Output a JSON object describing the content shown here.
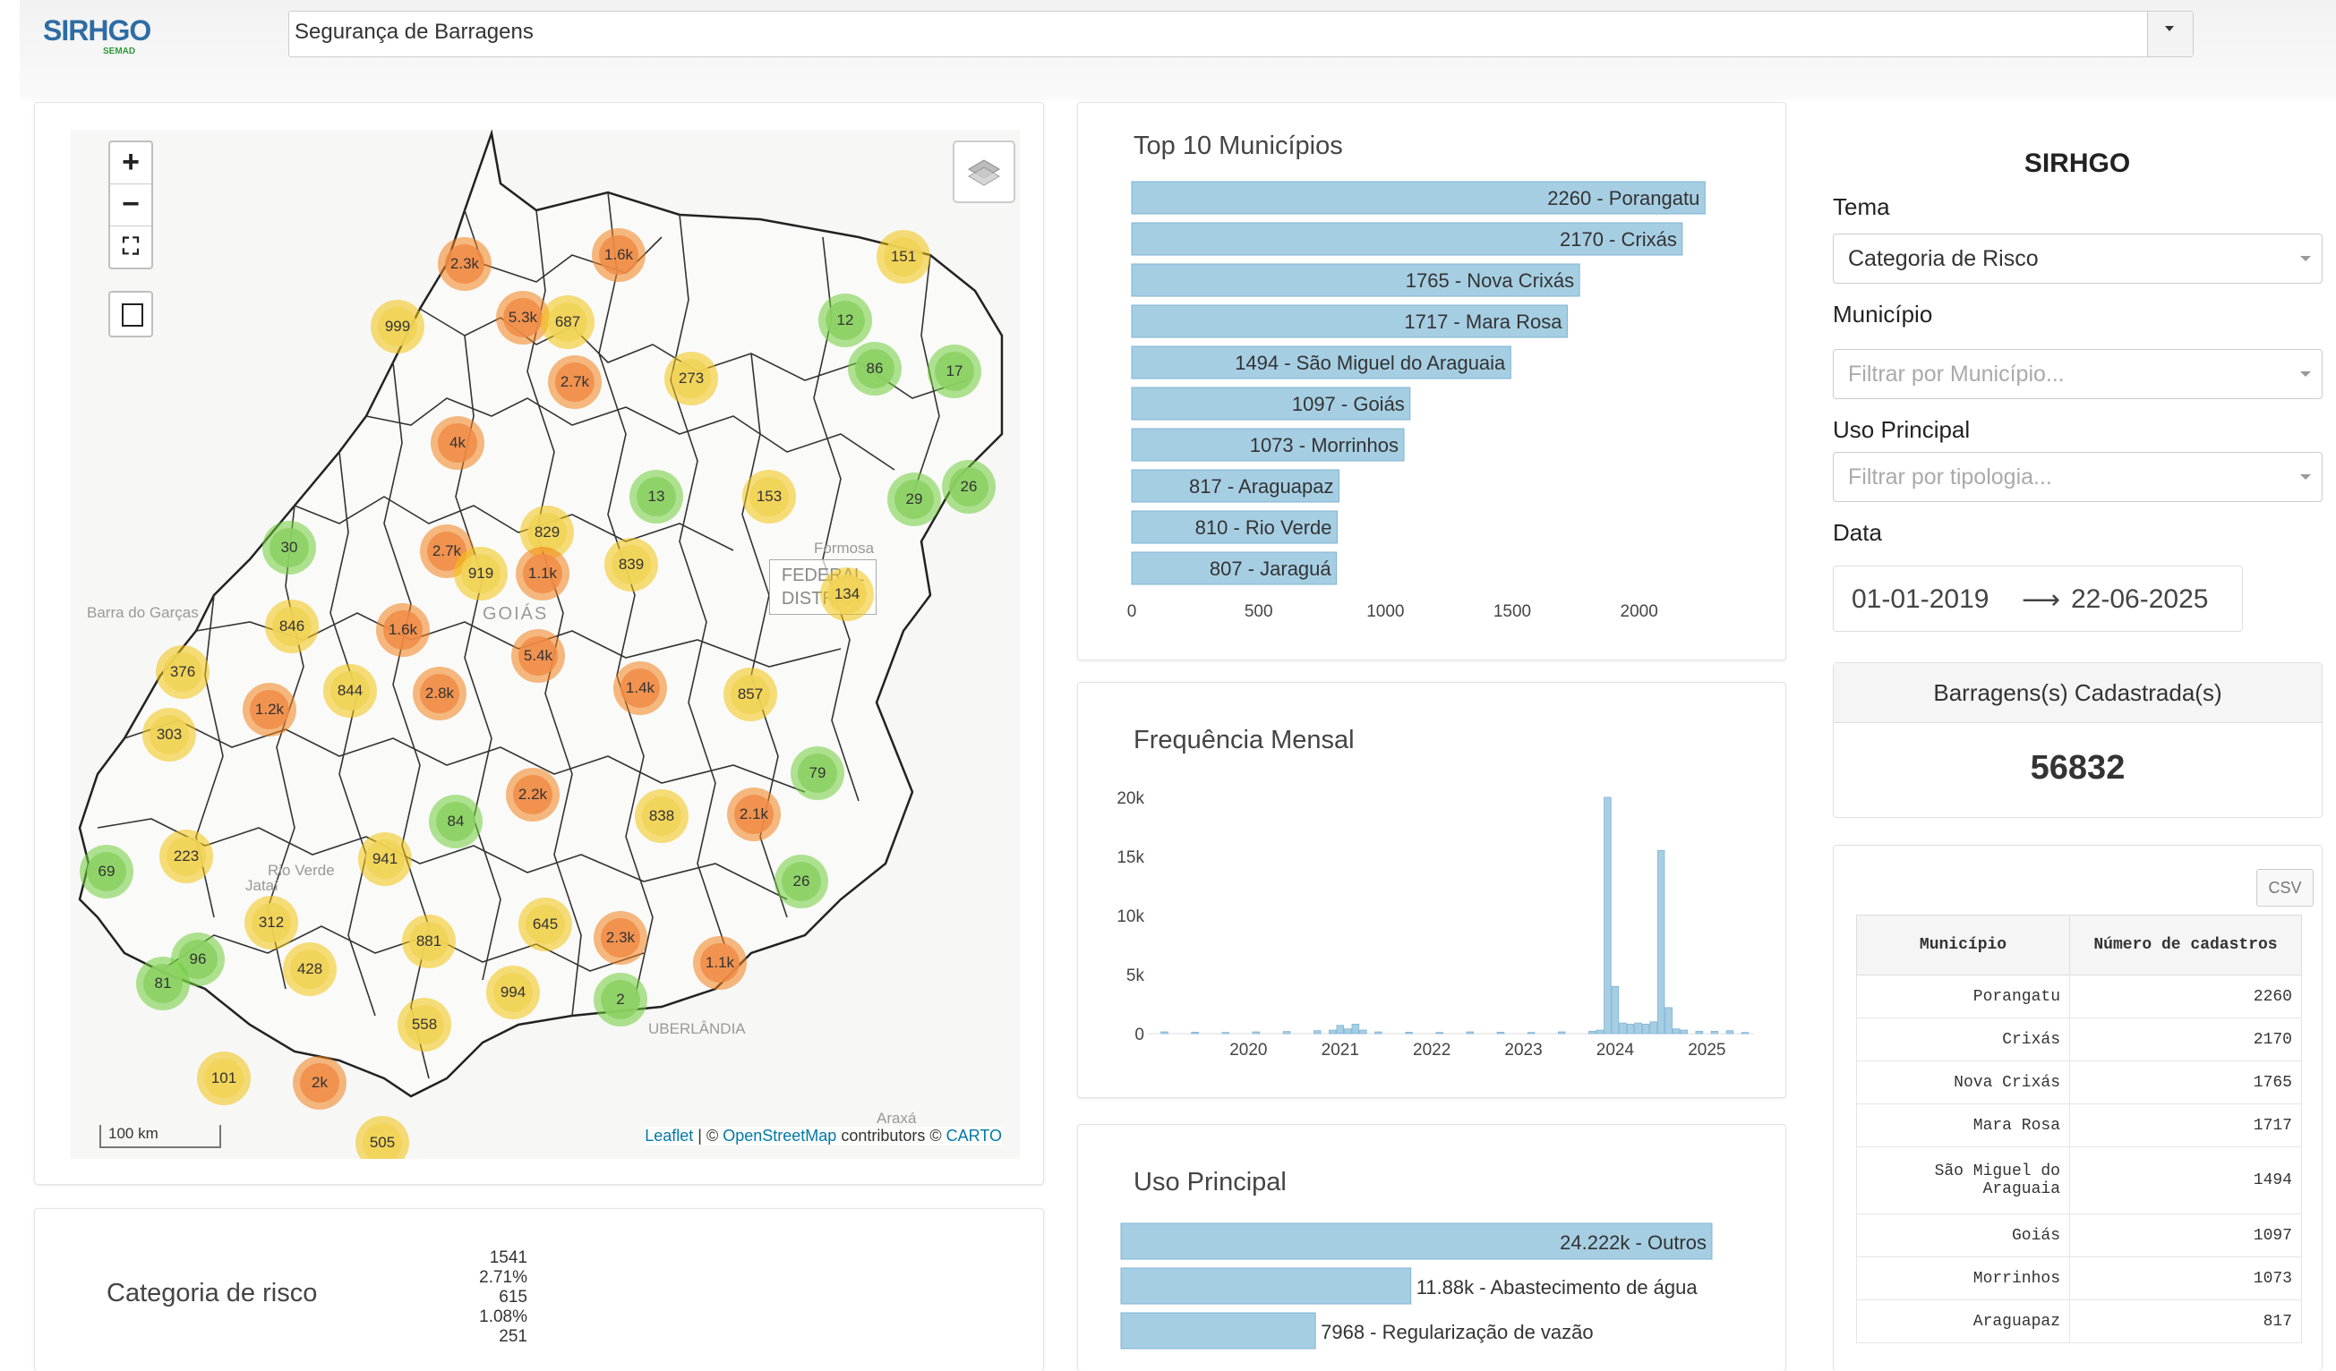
{
  "header": {
    "logo_text": "SIRHGO",
    "logo_sub": "SEMAD",
    "theme_select": "Segurança de Barragens"
  },
  "map": {
    "zoom_in": "+",
    "zoom_out": "−",
    "fullscreen": "⛶",
    "scale": "100 km",
    "attribution_leaflet": "Leaflet",
    "attribution_mid": " | © ",
    "attribution_osm": "OpenStreetMap",
    "attribution_contrib": " contributors © ",
    "attribution_carto": "CARTO",
    "labels": {
      "goias": "GOIÁS",
      "barra": "Barra do Garças",
      "uberlandia": "UBERLÂNDIA",
      "araxa": "Araxá",
      "formosa": "Formosa",
      "fed": "FEDERAL DISTRICT",
      "rio_verde": "Rio Verde",
      "jatai": "Jataí"
    },
    "clusters": [
      {
        "label": "2.3k",
        "level": "red"
      },
      {
        "label": "1.6k",
        "level": "red"
      },
      {
        "label": "151",
        "level": "yel"
      },
      {
        "label": "999",
        "level": "yel"
      },
      {
        "label": "5.3k",
        "level": "red"
      },
      {
        "label": "687",
        "level": "yel"
      },
      {
        "label": "12",
        "level": "grn"
      },
      {
        "label": "86",
        "level": "grn"
      },
      {
        "label": "17",
        "level": "grn"
      },
      {
        "label": "2.7k",
        "level": "red"
      },
      {
        "label": "273",
        "level": "yel"
      },
      {
        "label": "4k",
        "level": "red"
      },
      {
        "label": "13",
        "level": "grn"
      },
      {
        "label": "153",
        "level": "yel"
      },
      {
        "label": "29",
        "level": "grn"
      },
      {
        "label": "26",
        "level": "grn"
      },
      {
        "label": "829",
        "level": "yel"
      },
      {
        "label": "30",
        "level": "grn"
      },
      {
        "label": "2.7k",
        "level": "red"
      },
      {
        "label": "839",
        "level": "yel"
      },
      {
        "label": "919",
        "level": "yel"
      },
      {
        "label": "1.1k",
        "level": "red"
      },
      {
        "label": "134",
        "level": "yel"
      },
      {
        "label": "846",
        "level": "yel"
      },
      {
        "label": "1.6k",
        "level": "red"
      },
      {
        "label": "5.4k",
        "level": "red"
      },
      {
        "label": "376",
        "level": "yel"
      },
      {
        "label": "1.4k",
        "level": "red"
      },
      {
        "label": "844",
        "level": "yel"
      },
      {
        "label": "2.8k",
        "level": "red"
      },
      {
        "label": "857",
        "level": "yel"
      },
      {
        "label": "1.2k",
        "level": "red"
      },
      {
        "label": "303",
        "level": "yel"
      },
      {
        "label": "79",
        "level": "grn"
      },
      {
        "label": "2.2k",
        "level": "red"
      },
      {
        "label": "838",
        "level": "yel"
      },
      {
        "label": "2.1k",
        "level": "red"
      },
      {
        "label": "84",
        "level": "grn"
      },
      {
        "label": "223",
        "level": "yel"
      },
      {
        "label": "941",
        "level": "yel"
      },
      {
        "label": "69",
        "level": "grn"
      },
      {
        "label": "26",
        "level": "grn"
      },
      {
        "label": "312",
        "level": "yel"
      },
      {
        "label": "645",
        "level": "yel"
      },
      {
        "label": "881",
        "level": "yel"
      },
      {
        "label": "2.3k",
        "level": "red"
      },
      {
        "label": "96",
        "level": "grn"
      },
      {
        "label": "1.1k",
        "level": "red"
      },
      {
        "label": "428",
        "level": "yel"
      },
      {
        "label": "81",
        "level": "grn"
      },
      {
        "label": "994",
        "level": "yel"
      },
      {
        "label": "2",
        "level": "grn"
      },
      {
        "label": "558",
        "level": "yel"
      },
      {
        "label": "101",
        "level": "yel"
      },
      {
        "label": "2k",
        "level": "red"
      },
      {
        "label": "505",
        "level": "yel"
      }
    ]
  },
  "categoria": {
    "title": "Categoria de risco",
    "values": [
      "1541",
      "2.71%",
      "615",
      "1.08%",
      "251"
    ]
  },
  "top10": {
    "title": "Top 10 Municípios",
    "chart_data": {
      "type": "bar",
      "orientation": "horizontal",
      "categories": [
        "Porangatu",
        "Crixás",
        "Nova Crixás",
        "Mara Rosa",
        "São Miguel do Araguaia",
        "Goiás",
        "Morrinhos",
        "Araguapaz",
        "Rio Verde",
        "Jaraguá"
      ],
      "values": [
        2260,
        2170,
        1765,
        1717,
        1494,
        1097,
        1073,
        817,
        810,
        807
      ],
      "bar_labels": [
        "2260 - Porangatu",
        "2170 - Crixás",
        "1765 - Nova Crixás",
        "1717 - Mara Rosa",
        "1494 - São Miguel do Araguaia",
        "1097 - Goiás",
        "1073 - Morrinhos",
        "817 - Araguapaz",
        "810 - Rio Verde",
        "807 - Jaraguá"
      ],
      "xticks": [
        "0",
        "500",
        "1000",
        "1500",
        "2000"
      ],
      "xlim": [
        0,
        2400
      ],
      "color": "#a6cee3"
    }
  },
  "freq": {
    "title": "Frequência Mensal",
    "chart_data": {
      "type": "bar",
      "x": [
        "2019-02",
        "2019-06",
        "2019-10",
        "2020-02",
        "2020-06",
        "2020-10",
        "2020-12",
        "2021-01",
        "2021-02",
        "2021-03",
        "2021-04",
        "2021-06",
        "2021-10",
        "2022-02",
        "2022-06",
        "2022-10",
        "2023-02",
        "2023-06",
        "2023-10",
        "2023-11",
        "2023-12",
        "2024-01",
        "2024-02",
        "2024-03",
        "2024-04",
        "2024-05",
        "2024-06",
        "2024-07",
        "2024-08",
        "2024-09",
        "2024-10",
        "2024-12",
        "2025-02",
        "2025-04",
        "2025-06"
      ],
      "values": [
        150,
        120,
        100,
        150,
        180,
        250,
        300,
        700,
        400,
        800,
        300,
        150,
        120,
        100,
        150,
        120,
        100,
        150,
        200,
        300,
        20000,
        4000,
        900,
        800,
        900,
        800,
        1000,
        15500,
        2200,
        400,
        300,
        200,
        200,
        250,
        100
      ],
      "yticks": [
        "0",
        "5k",
        "10k",
        "15k",
        "20k"
      ],
      "xticks": [
        "2020",
        "2021",
        "2022",
        "2023",
        "2024",
        "2025"
      ],
      "ylim": [
        0,
        20000
      ],
      "xlim": [
        "2019-01",
        "2025-06"
      ],
      "color": "#a6cee3"
    }
  },
  "uso": {
    "title": "Uso Principal",
    "chart_data": {
      "type": "bar",
      "orientation": "horizontal",
      "categories": [
        "Outros",
        "Abastecimento de água",
        "Regularização de vazão"
      ],
      "values": [
        24222,
        11880,
        7968
      ],
      "bar_labels": [
        "24.222k - Outros",
        "11.88k - Abastecimento de água",
        "7968 - Regularização de vazão"
      ],
      "color": "#a6cee3"
    }
  },
  "sidebar": {
    "title": "SIRHGO",
    "tema_label": "Tema",
    "tema_value": "Categoria de Risco",
    "municipio_label": "Município",
    "municipio_placeholder": "Filtrar por Município...",
    "uso_label": "Uso Principal",
    "uso_placeholder": "Filtrar por tipologia...",
    "data_label": "Data",
    "date_start": "01-01-2019",
    "date_arrow": "⟶",
    "date_end": "22-06-2025",
    "count_title": "Barragens(s) Cadastrada(s)",
    "count_value": "56832",
    "csv_label": "CSV",
    "table": {
      "col_municipio": "Município",
      "col_numero": "Número de cadastros",
      "rows": [
        {
          "municipio": "Porangatu",
          "numero": "2260"
        },
        {
          "municipio": "Crixás",
          "numero": "2170"
        },
        {
          "municipio": "Nova Crixás",
          "numero": "1765"
        },
        {
          "municipio": "Mara Rosa",
          "numero": "1717"
        },
        {
          "municipio": "São Miguel do Araguaia",
          "numero": "1494"
        },
        {
          "municipio": "Goiás",
          "numero": "1097"
        },
        {
          "municipio": "Morrinhos",
          "numero": "1073"
        },
        {
          "municipio": "Araguapaz",
          "numero": "817"
        }
      ]
    }
  }
}
